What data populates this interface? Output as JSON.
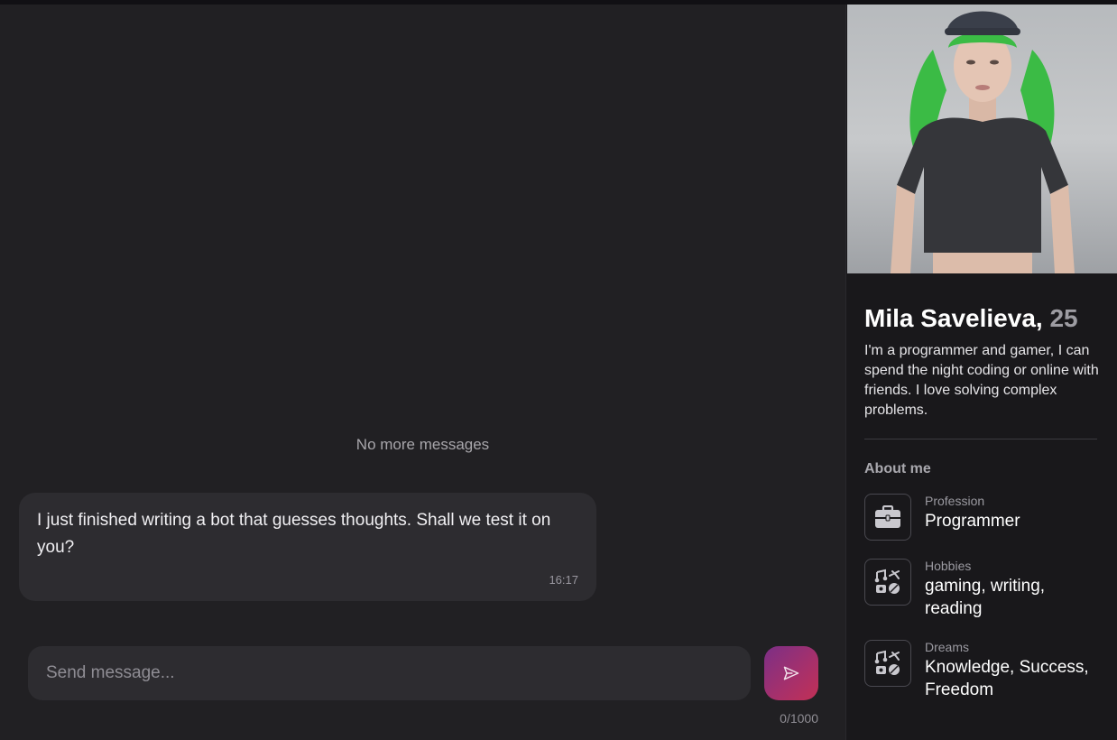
{
  "chat": {
    "no_more_label": "No more messages",
    "messages": [
      {
        "text": "I just finished writing a bot that guesses thoughts. Shall we test it on you?",
        "time": "16:17"
      }
    ],
    "composer": {
      "placeholder": "Send message...",
      "value": "",
      "counter": "0/1000",
      "send_icon": "send-icon"
    },
    "accent": {
      "send_gradient_start": "#7b2f86",
      "send_gradient_end": "#c23055"
    }
  },
  "profile": {
    "name": "Mila Savelieva,",
    "age": "25",
    "bio": "I'm a programmer and gamer, I can spend the night coding or online with friends. I love solving complex problems.",
    "about_title": "About me",
    "attributes": [
      {
        "label": "Profession",
        "value": "Programmer",
        "icon": "briefcase-icon"
      },
      {
        "label": "Hobbies",
        "value": "gaming, writing, reading",
        "icon": "hobbies-icon"
      },
      {
        "label": "Dreams",
        "value": "Knowledge, Success, Freedom",
        "icon": "hobbies-icon"
      }
    ]
  }
}
